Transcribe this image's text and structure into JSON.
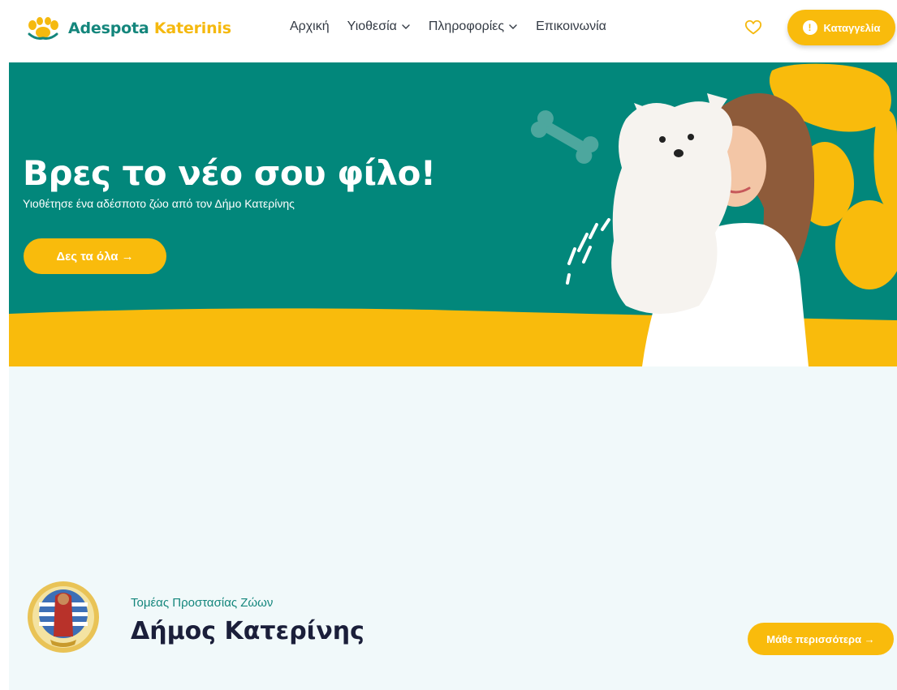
{
  "header": {
    "logo": {
      "part1": "Adespota",
      "part2": "Katerinis"
    },
    "nav": [
      {
        "label": "Αρχική",
        "dropdown": false
      },
      {
        "label": "Υιοθεσία",
        "dropdown": true
      },
      {
        "label": "Πληροφορίες",
        "dropdown": true
      },
      {
        "label": "Επικοινωνία",
        "dropdown": false
      }
    ],
    "favorites_icon": "heart-outline-icon",
    "report_button": {
      "label": "Καταγγελία",
      "icon": "exclamation-circle-icon"
    }
  },
  "hero": {
    "title": "Βρες το νέο σου φίλο!",
    "subtitle": "Υιοθέτησε ένα αδέσποτο ζώο από τον Δήμο Κατερίνης",
    "button": "Δες τα όλα →",
    "image": "woman-holding-white-dog",
    "decorations": [
      "bone-icon",
      "paw-print-shape"
    ]
  },
  "section": {
    "eyebrow": "Τομέας Προστασίας Ζώων",
    "title": "Δήμος Κατερίνης",
    "emblem": "municipality-emblem",
    "button": "Μάθε περισσότερα →"
  },
  "colors": {
    "teal": "#02877b",
    "yellow": "#f9bb0c",
    "light_bg": "#f1f9fa",
    "navy": "#1b1f3a"
  }
}
